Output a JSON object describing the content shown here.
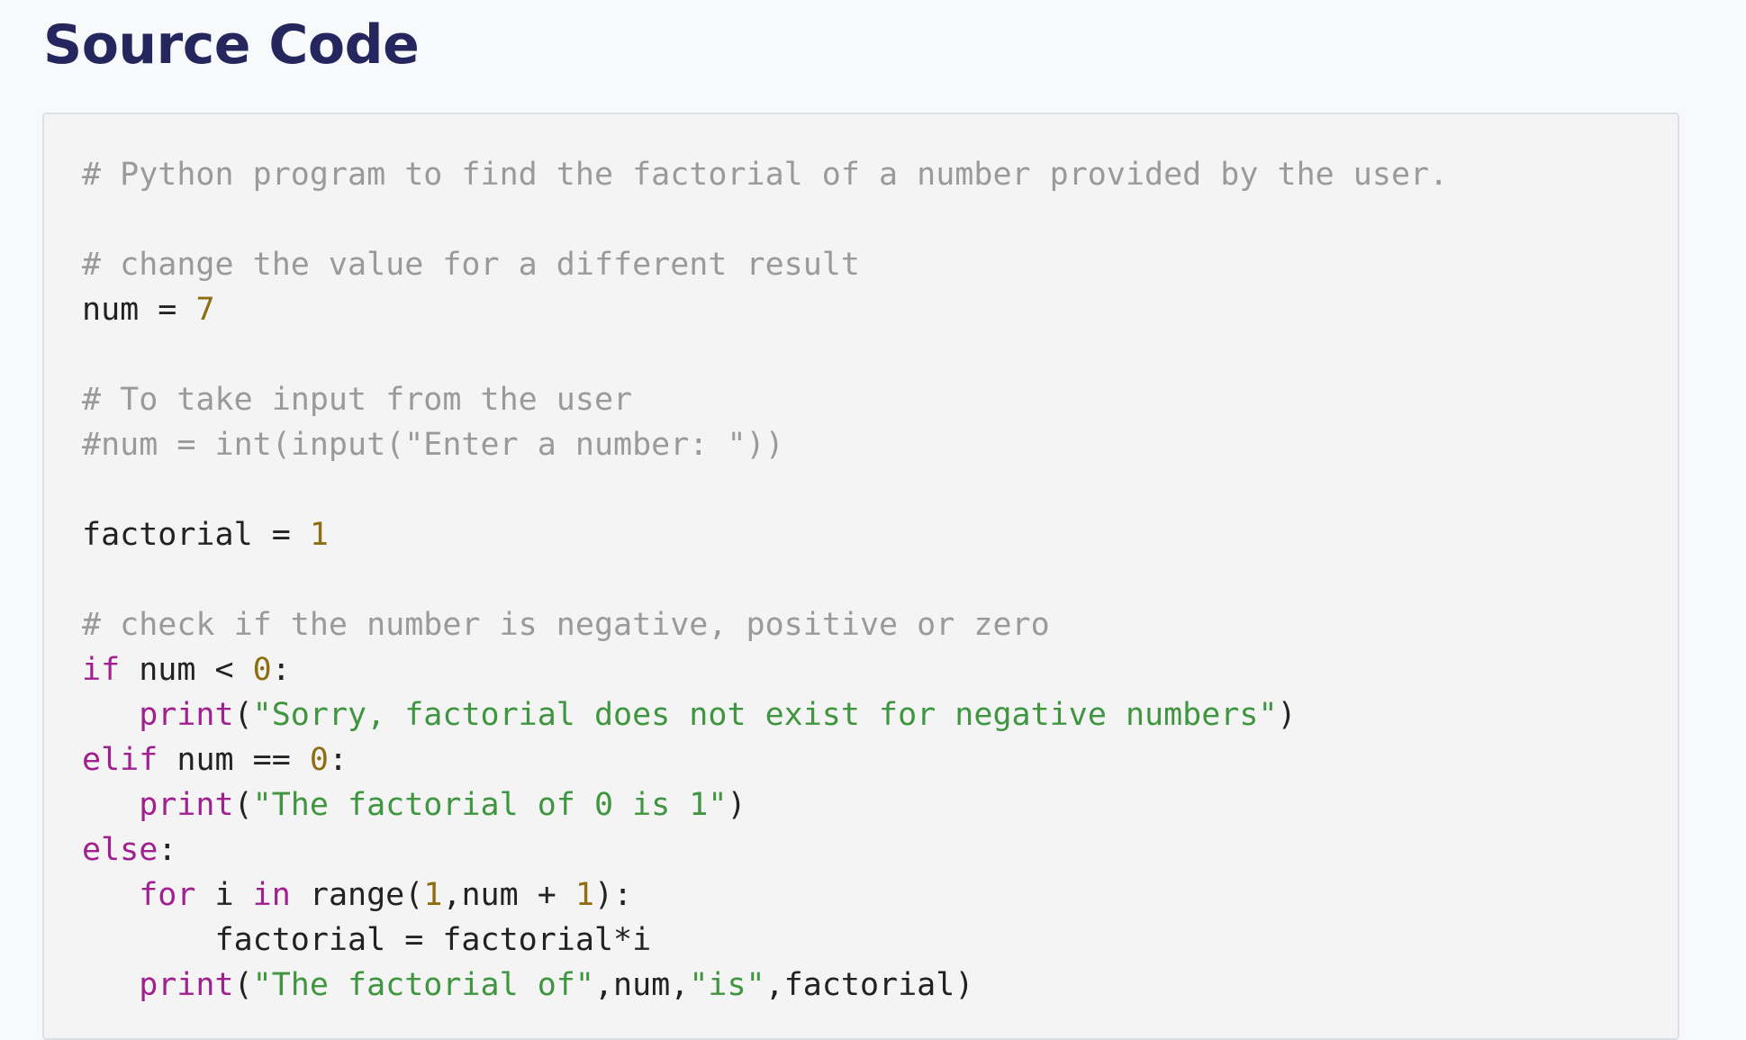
{
  "header": {
    "title": "Source Code"
  },
  "code": {
    "lines": [
      [
        {
          "t": "# Python program to find the factorial of a number provided by the user.",
          "c": "c"
        }
      ],
      [],
      [
        {
          "t": "# change the value for a different result",
          "c": "c"
        }
      ],
      [
        {
          "t": "num = ",
          "c": ""
        },
        {
          "t": "7",
          "c": "n"
        }
      ],
      [],
      [
        {
          "t": "# To take input from the user",
          "c": "c"
        }
      ],
      [
        {
          "t": "#num = int(input(\"Enter a number: \"))",
          "c": "c"
        }
      ],
      [],
      [
        {
          "t": "factorial = ",
          "c": ""
        },
        {
          "t": "1",
          "c": "n"
        }
      ],
      [],
      [
        {
          "t": "# check if the number is negative, positive or zero",
          "c": "c"
        }
      ],
      [
        {
          "t": "if",
          "c": "k"
        },
        {
          "t": " num < ",
          "c": ""
        },
        {
          "t": "0",
          "c": "n"
        },
        {
          "t": ":",
          "c": ""
        }
      ],
      [
        {
          "t": "   ",
          "c": ""
        },
        {
          "t": "print",
          "c": "k"
        },
        {
          "t": "(",
          "c": ""
        },
        {
          "t": "\"Sorry, factorial does not exist for negative numbers\"",
          "c": "s"
        },
        {
          "t": ")",
          "c": ""
        }
      ],
      [
        {
          "t": "elif",
          "c": "k"
        },
        {
          "t": " num == ",
          "c": ""
        },
        {
          "t": "0",
          "c": "n"
        },
        {
          "t": ":",
          "c": ""
        }
      ],
      [
        {
          "t": "   ",
          "c": ""
        },
        {
          "t": "print",
          "c": "k"
        },
        {
          "t": "(",
          "c": ""
        },
        {
          "t": "\"The factorial of 0 is 1\"",
          "c": "s"
        },
        {
          "t": ")",
          "c": ""
        }
      ],
      [
        {
          "t": "else",
          "c": "k"
        },
        {
          "t": ":",
          "c": ""
        }
      ],
      [
        {
          "t": "   ",
          "c": ""
        },
        {
          "t": "for",
          "c": "k"
        },
        {
          "t": " i ",
          "c": ""
        },
        {
          "t": "in",
          "c": "k"
        },
        {
          "t": " range(",
          "c": ""
        },
        {
          "t": "1",
          "c": "n"
        },
        {
          "t": ",num + ",
          "c": ""
        },
        {
          "t": "1",
          "c": "n"
        },
        {
          "t": "):",
          "c": ""
        }
      ],
      [
        {
          "t": "       factorial = factorial*i",
          "c": ""
        }
      ],
      [
        {
          "t": "   ",
          "c": ""
        },
        {
          "t": "print",
          "c": "k"
        },
        {
          "t": "(",
          "c": ""
        },
        {
          "t": "\"The factorial of\"",
          "c": "s"
        },
        {
          "t": ",num,",
          "c": ""
        },
        {
          "t": "\"is\"",
          "c": "s"
        },
        {
          "t": ",factorial)",
          "c": ""
        }
      ]
    ]
  }
}
